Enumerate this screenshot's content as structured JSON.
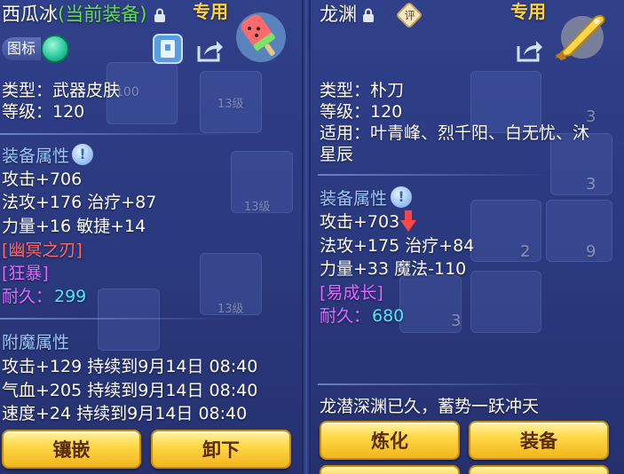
{
  "left": {
    "item_name": "西瓜冰",
    "equipped_tag": "(当前装备)",
    "exclusive_label": "专用",
    "icon_toggle_label": "图标",
    "type_line": "类型：武器皮肤",
    "level_line": "等级：120",
    "base_section": "装备属性",
    "base_stats": [
      "攻击+706",
      "法攻+176 治疗+87",
      "力量+16 敏捷+14"
    ],
    "special_1": "[幽冥之刃]",
    "special_2": "[狂暴]",
    "durability_label": "耐久：",
    "durability_value": "299",
    "enchant_section": "附魔属性",
    "enchant_stats": [
      "攻击+129 持续到9月14日 08:40",
      "气血+205 持续到9月14日 08:40",
      "速度+24 持续到9月14日 08:40"
    ],
    "buttons": {
      "inlay": "镶嵌",
      "unequip": "卸下"
    }
  },
  "right": {
    "item_name": "龙渊",
    "rating_badge": "评",
    "exclusive_label": "专用",
    "type_line": "类型：朴刀",
    "level_line": "等级：120",
    "apply_line_1": "适用：叶青峰、烈千阳、白无忧、沐",
    "apply_line_2": "星辰",
    "base_section": "装备属性",
    "attack_stat": "攻击+703",
    "base_stats": [
      "法攻+175 治疗+84",
      "力量+33 魔法-110"
    ],
    "special_1": "[易成长]",
    "durability_label": "耐久：",
    "durability_value": "680",
    "flavor_text": "龙潜深渊已久，蓄势一跃冲天",
    "buttons": {
      "refine": "炼化",
      "equip": "装备"
    }
  },
  "background_labels": [
    "100",
    "13级",
    "13级",
    "13级",
    "3",
    "2",
    "9",
    "3",
    "3"
  ],
  "colors": {
    "green": "#5ee04a",
    "gold": "#ffd23a",
    "section": "#9ec6ff",
    "red": "#ff6a6a",
    "purple": "#e06aff",
    "cyan": "#4fe6ff",
    "button": "#ffd94a"
  }
}
